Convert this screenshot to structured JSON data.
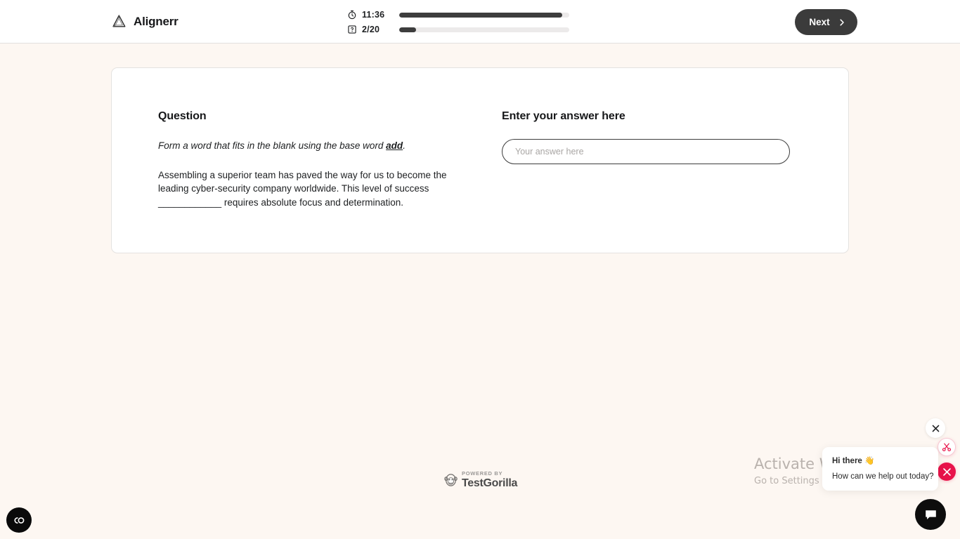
{
  "header": {
    "brand_name": "Alignerr",
    "brand_logo_icon": "penrose-triangle-logo",
    "timer": {
      "icon": "stopwatch-icon",
      "label": "11:36",
      "progress_percent": 96
    },
    "questions": {
      "icon": "question-card-icon",
      "label": "2/20",
      "progress_percent": 10
    },
    "next_button": {
      "label": "Next",
      "icon": "chevron-right-icon"
    }
  },
  "card": {
    "question_section": {
      "title": "Question",
      "prompt_prefix": "Form a word that fits in the blank using the base word ",
      "base_word": "add",
      "prompt_suffix": ".",
      "passage": "Assembling a superior team has paved the way for us to become the leading cyber-security company worldwide. This level of success ____________ requires absolute focus and determination."
    },
    "answer_section": {
      "title": "Enter your answer here",
      "input_value": "",
      "input_placeholder": "Your answer here"
    }
  },
  "footer": {
    "powered_by": "POWERED BY",
    "vendor": "TestGorilla",
    "vendor_icon": "gorilla-icon"
  },
  "watermark": {
    "title": "Activate Windows",
    "subtitle": "Go to Settings to activate Windows."
  },
  "accessibility_widget": {
    "icon": "co-accessibility-icon"
  },
  "chat": {
    "close_icon": "close-x-icon",
    "scissors_icon": "scissors-icon",
    "solid_icon": "collapse-arrows-icon",
    "greeting": "Hi there 👋",
    "question": "How can we help out today?",
    "launcher_icon": "chat-bubble-icon"
  },
  "colors": {
    "page_background": "#fdf7f2",
    "card_background": "#ffffff",
    "accent_dark": "#3b3b3b",
    "accent_red": "#e8134a",
    "text_primary": "#1d1f21",
    "muted": "#a9a6a4"
  }
}
